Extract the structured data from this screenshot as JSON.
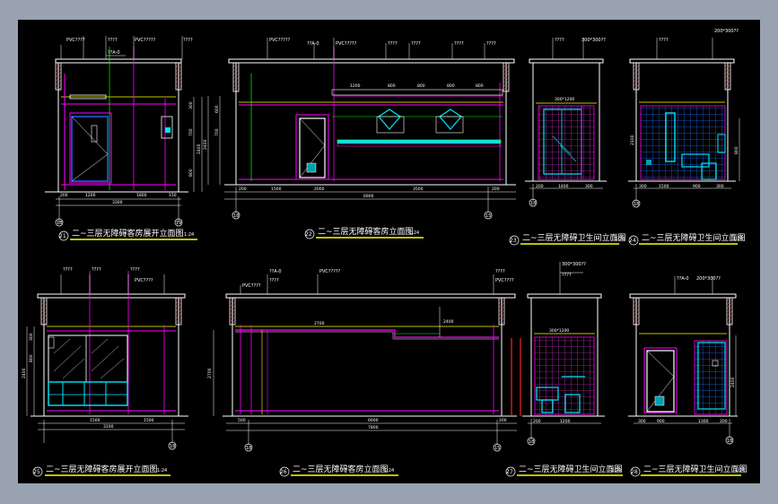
{
  "colors": {
    "background": "#98a2b0",
    "canvas": "#000000",
    "wall": "#ffffff",
    "magenta": "#ff00ff",
    "cyan": "#00e5ff",
    "yellow": "#ffff00",
    "green": "#00ff00",
    "hatch": "#ff4040"
  },
  "views": [
    {
      "id": "v21",
      "number": "21",
      "title": "二~三层无障碍客房展开立面图",
      "scale": "1:24",
      "grids": [
        "18",
        "19"
      ],
      "labels": [
        "PVC????",
        "????",
        "PVC?????",
        "????",
        "??A-0"
      ],
      "dims_h": [
        "200",
        "1200",
        "1800",
        "150"
      ],
      "dim_total": "3300",
      "dims_v": [
        "300",
        "700",
        "2400",
        "800"
      ]
    },
    {
      "id": "v22",
      "number": "22",
      "title": "二~三层无障碍客房立面图",
      "scale": "1:24",
      "grids": [
        "18",
        "15"
      ],
      "labels": [
        "PVC?????",
        "??A-0",
        "PVC?????",
        "????",
        "????",
        "????",
        "????"
      ],
      "dims_h": [
        "200",
        "1500",
        "2000",
        "3500",
        "200"
      ],
      "dim_total": "6900",
      "dims_top": [
        "1200",
        "800",
        "800",
        "800",
        "800"
      ],
      "dims_v": [
        "600",
        "700",
        "2400"
      ]
    },
    {
      "id": "v23",
      "number": "23",
      "title": "二~三层无障碍卫生间立面图",
      "scale": "1:24",
      "grids": [
        "18"
      ],
      "labels": [
        "????",
        "300*300??"
      ],
      "dims_h": [
        "200",
        "1400",
        "300"
      ],
      "dims_top": [
        "300*1200"
      ]
    },
    {
      "id": "v24",
      "number": "24",
      "title": "二~三层无障碍卫生间立面图",
      "scale": "1:24",
      "grids": [
        "18"
      ],
      "labels": [
        "????",
        "200*300??"
      ],
      "dims_h": [
        "300",
        "1500",
        "900",
        "300"
      ],
      "dims_v": [
        "2100",
        "800"
      ]
    },
    {
      "id": "v25",
      "number": "25",
      "title": "二~三层无障碍客房展开立面图",
      "scale": "1:24",
      "grids": [
        "18"
      ],
      "labels": [
        "????",
        "????",
        "????",
        "PVC????"
      ],
      "dims_h": [
        "1500",
        "1500"
      ],
      "dim_total": "3100",
      "dims_v": [
        "300",
        "800",
        "2400"
      ]
    },
    {
      "id": "v26",
      "number": "26",
      "title": "二~三层无障碍客房立面图",
      "scale": "1:24",
      "grids": [
        "18",
        "15"
      ],
      "labels": [
        "PVC????",
        "??A-0",
        "????",
        "PVC?????",
        "????",
        "PVC????"
      ],
      "dims_h": [
        "500",
        "6600",
        "200"
      ],
      "dim_total": "7800",
      "dims_top": [
        "2700",
        "2400"
      ],
      "dims_v": [
        "2700"
      ]
    },
    {
      "id": "v27",
      "number": "27",
      "title": "二~三层无障碍卫生间立面图",
      "scale": "1:24",
      "grids": [
        "18"
      ],
      "labels": [
        "300*300??",
        "????"
      ],
      "dims_h": [
        "200",
        "1200"
      ],
      "dims_top": [
        "300*1200"
      ]
    },
    {
      "id": "v28",
      "number": "28",
      "title": "二~三层无障碍卫生间立面图",
      "scale": "1:24",
      "grids": [
        "18"
      ],
      "labels": [
        "??A-0",
        "200*300??"
      ],
      "dims_h": [
        "300",
        "900",
        "1300",
        "200"
      ],
      "dims_v": [
        "2400"
      ]
    }
  ]
}
